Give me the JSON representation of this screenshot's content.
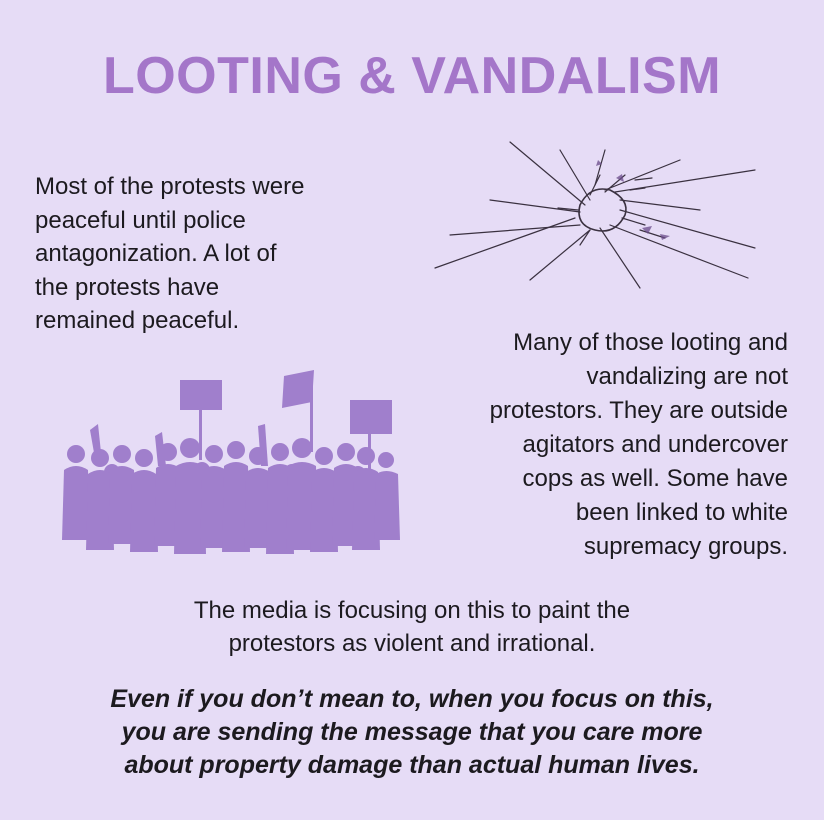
{
  "title": "LOOTING & VANDALISM",
  "paragraph_left": [
    "Most of the protests were",
    "peaceful until police",
    "antagonization. A lot of",
    "the protests have",
    "remained peaceful."
  ],
  "paragraph_right": [
    "Many of those looting and",
    "vandalizing are not",
    "protestors. They are outside",
    "agitators and undercover",
    "cops as well. Some have",
    "been linked to white",
    "supremacy groups."
  ],
  "paragraph_media": [
    "The media is focusing on this to paint the",
    "protestors as violent and irrational."
  ],
  "paragraph_warning": [
    "Even if you don’t mean to, when you focus on this,",
    "you are sending the message that you care more",
    "about property damage than actual human lives."
  ],
  "colors": {
    "background": "#e6dcf6",
    "title": "#a476c9",
    "crowd": "#a07fcc",
    "text": "#1c1a1f"
  },
  "icons": {
    "glass": "broken-glass-icon",
    "crowd": "protest-crowd-icon"
  }
}
